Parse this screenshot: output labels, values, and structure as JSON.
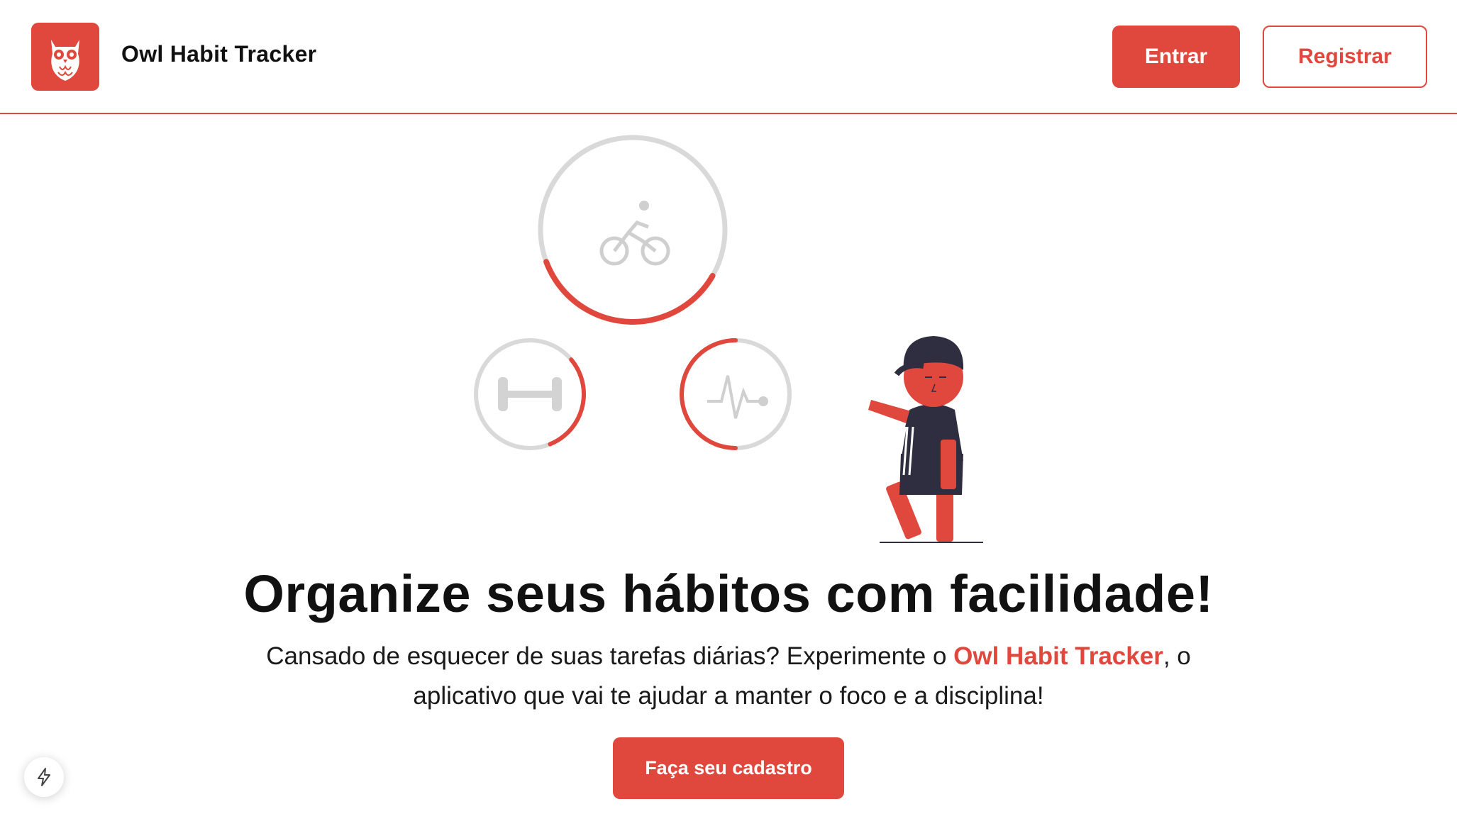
{
  "header": {
    "app_title": "Owl Habit Tracker",
    "logo_icon": "owl-icon",
    "login_label": "Entrar",
    "register_label": "Registrar"
  },
  "hero": {
    "illustration_icons": [
      "bicycle-icon",
      "dumbbell-icon",
      "heartbeat-icon"
    ],
    "progress": {
      "bicycle_ring": 0.36,
      "dumbbell_ring": 0.3,
      "heartbeat_ring": 0.5
    },
    "headline": "Organize seus hábitos com facilidade!",
    "subtext_part1": "Cansado de esquecer de suas tarefas diárias? Experimente o ",
    "subtext_highlight": "Owl Habit Tracker",
    "subtext_part2": ", o",
    "subtext_line2": "aplicativo que vai te ajudar a manter o foco e a disciplina!",
    "cta_label": "Faça seu cadastro"
  },
  "dev_badge": {
    "icon": "lightning-icon"
  },
  "colors": {
    "accent": "#e0473d",
    "ring_track": "#d9d9d9",
    "figure_dark": "#2f2e41",
    "text": "#111111"
  }
}
